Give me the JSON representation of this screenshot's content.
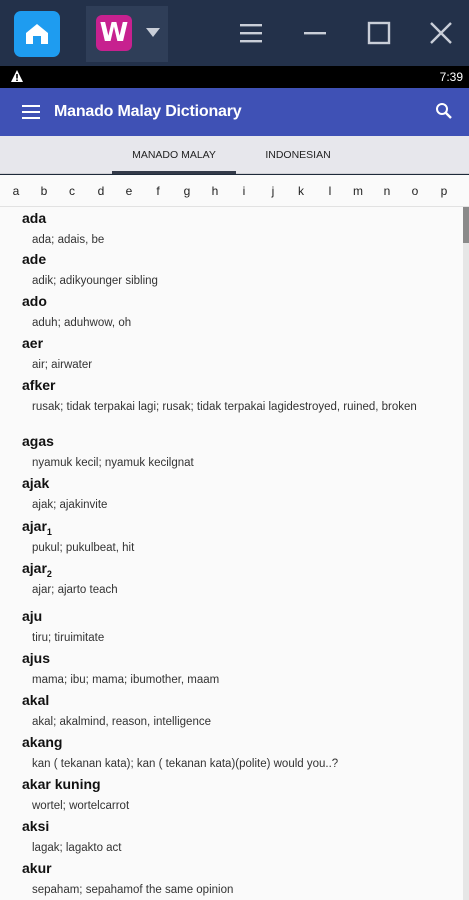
{
  "window": {
    "home_icon": "home-icon",
    "app_icon_letter": "W",
    "controls": [
      "menu-icon",
      "minimize-icon",
      "maximize-icon",
      "close-icon"
    ]
  },
  "statusbar": {
    "time": "7:39"
  },
  "appbar": {
    "title": "Manado Malay Dictionary"
  },
  "tabs": [
    {
      "label": "MANADO MALAY"
    },
    {
      "label": "INDONESIAN"
    }
  ],
  "alphabet": [
    "a",
    "b",
    "c",
    "d",
    "e",
    "f",
    "g",
    "h",
    "i",
    "j",
    "k",
    "l",
    "m",
    "n",
    "o",
    "p"
  ],
  "entries": [
    {
      "word": "ada",
      "sub": "",
      "def": "ada; adais, be"
    },
    {
      "word": "ade",
      "sub": "",
      "def": "adik; adikyounger sibling"
    },
    {
      "word": "ado",
      "sub": "",
      "def": "aduh; aduhwow, oh"
    },
    {
      "word": "aer",
      "sub": "",
      "def": "air; airwater"
    },
    {
      "word": "afker",
      "sub": "",
      "def": "rusak; tidak terpakai lagi; rusak; tidak terpakai lagidestroyed, ruined, broken"
    },
    {
      "word": "agas",
      "sub": "",
      "def": "nyamuk kecil; nyamuk kecilgnat"
    },
    {
      "word": "ajak",
      "sub": "",
      "def": "ajak; ajakinvite"
    },
    {
      "word": "ajar",
      "sub": "1",
      "def": "pukul; pukulbeat, hit"
    },
    {
      "word": "ajar",
      "sub": "2",
      "def": "ajar; ajarto teach"
    },
    {
      "word": "aju",
      "sub": "",
      "def": "tiru; tiruimitate"
    },
    {
      "word": "ajus",
      "sub": "",
      "def": "mama; ibu; mama; ibumother, maam"
    },
    {
      "word": "akal",
      "sub": "",
      "def": "akal; akalmind, reason, intelligence"
    },
    {
      "word": "akang",
      "sub": "",
      "def": "kan ( tekanan kata); kan ( tekanan kata)(polite) would you..?"
    },
    {
      "word": "akar kuning",
      "sub": "",
      "def": "wortel; wortelcarrot"
    },
    {
      "word": "aksi",
      "sub": "",
      "def": "lagak; lagakto act"
    },
    {
      "word": "akur",
      "sub": "",
      "def": "sepaham; sepahamof the same opinion"
    }
  ]
}
